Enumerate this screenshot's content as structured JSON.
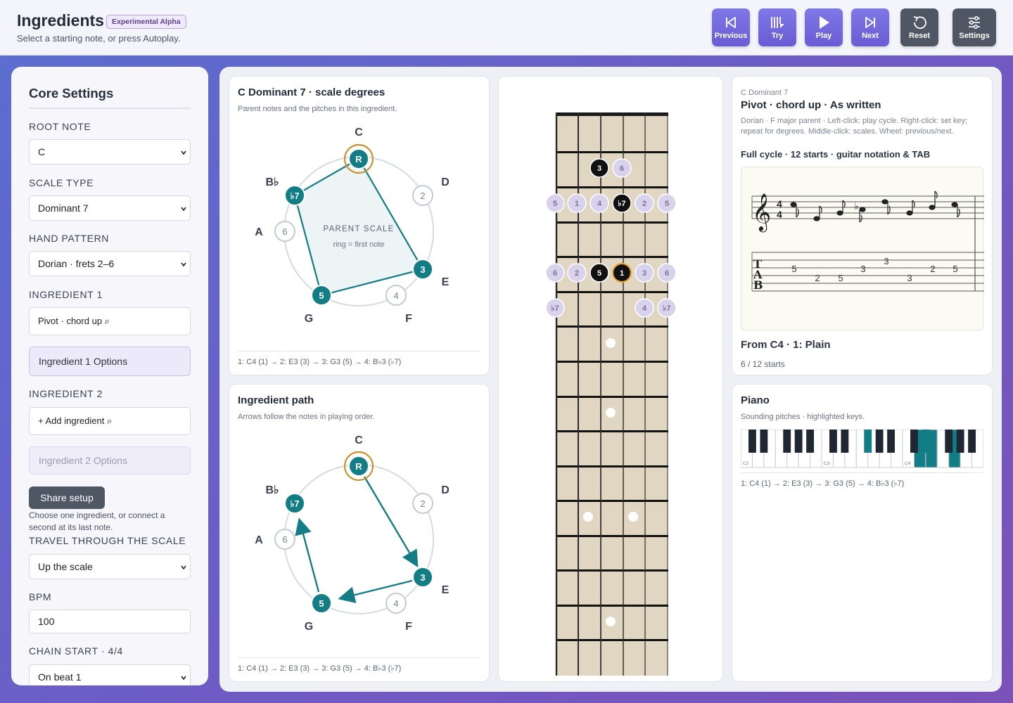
{
  "app": {
    "title": "Ingredients",
    "badge": "Experimental Alpha",
    "subtitle": "Select a starting note, or press Autoplay."
  },
  "toolbar": {
    "previous": "Previous",
    "try": "Try",
    "play": "Play",
    "next": "Next",
    "reset": "Reset",
    "settings": "Settings"
  },
  "sidebar": {
    "heading": "Core Settings",
    "root_label": "ROOT NOTE",
    "root_value": "C",
    "scale_label": "SCALE TYPE",
    "scale_value": "Dominant 7",
    "hand_label": "HAND PATTERN",
    "hand_value": "Dorian · frets 2–6",
    "ing1_label": "INGREDIENT 1",
    "ing1_value": "Pivot · chord up ⌕",
    "ing1_options": "Ingredient 1 Options",
    "ing2_label": "INGREDIENT 2",
    "ing2_value": "+  Add ingredient ⌕",
    "ing2_options": "Ingredient 2 Options",
    "share": "Share setup",
    "share_note": "Choose one ingredient, or connect a second at its last note.",
    "travel_label": "TRAVEL THROUGH THE SCALE",
    "travel_value": "Up the scale",
    "bpm_label": "BPM",
    "bpm_value": "100",
    "chain_label": "CHAIN START · 4/4",
    "chain_value": "On beat 1"
  },
  "degrees_card": {
    "title": "C Dominant 7 · scale degrees",
    "subtitle": "Parent notes and the pitches in this ingredient.",
    "note_labels": [
      "C",
      "D",
      "E",
      "F",
      "G",
      "A",
      "B♭"
    ],
    "center_title": "PARENT SCALE",
    "center_sub": "ring = first note",
    "footer": "1: C4 (1) → 2: E3 (3) → 3: G3 (5) → 4: B♭3 (♭7)"
  },
  "path_card": {
    "title": "Ingredient path",
    "subtitle": "Arrows follow the notes in playing order.",
    "note_labels": [
      "C",
      "D",
      "E",
      "F",
      "G",
      "A",
      "B♭"
    ],
    "footer": "1: C4 (1) → 2: E3 (3) → 3: G3 (5) → 4: B♭3 (♭7)"
  },
  "degree_nodes": [
    "R",
    "2",
    "3",
    "4",
    "5",
    "6",
    "♭7"
  ],
  "fretboard": {
    "row1": [
      "3",
      "6"
    ],
    "row2": [
      "5",
      "1",
      "4",
      "♭7",
      "2",
      "5"
    ],
    "row4": [
      "6",
      "2",
      "5",
      "1",
      "3",
      "6"
    ],
    "row5": [
      "♭7",
      "4",
      "♭7"
    ]
  },
  "info_card": {
    "small": "C Dominant 7",
    "title": "Pivot · chord up · As written",
    "desc": "Dorian · F major parent · Left-click: play cycle. Right-click: set key; repeat for degrees. Middle-click: scales. Wheel: previous/next.",
    "cycle": "Full cycle · 12 starts · guitar notation & TAB",
    "tab_numbers": [
      "5",
      "2",
      "5",
      "3",
      "3",
      "3",
      "2",
      "5"
    ],
    "from": "From C4 · 1: Plain",
    "starts": "6 / 12 starts"
  },
  "piano_card": {
    "title": "Piano",
    "subtitle": "Sounding pitches · highlighted keys.",
    "octave_labels": [
      "C2",
      "C3",
      "C4"
    ],
    "footer": "1: C4 (1) → 2: E3 (3) → 3: G3 (5) → 4: B♭3 (♭7)"
  },
  "colors": {
    "teal": "#137d86",
    "ring": "#c8922e",
    "purple": "#6a5bd4"
  }
}
